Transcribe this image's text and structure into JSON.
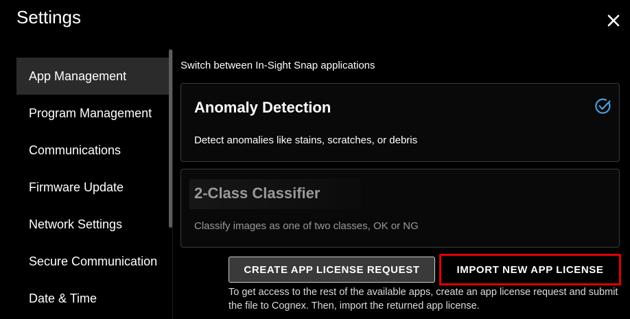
{
  "header": {
    "title": "Settings"
  },
  "sidebar": {
    "items": [
      {
        "label": "App Management",
        "active": true
      },
      {
        "label": "Program Management"
      },
      {
        "label": "Communications"
      },
      {
        "label": "Firmware Update"
      },
      {
        "label": "Network Settings"
      },
      {
        "label": "Secure Communication"
      },
      {
        "label": "Date & Time"
      }
    ]
  },
  "main": {
    "subtitle": "Switch between In-Sight Snap applications",
    "apps": [
      {
        "title": "Anomaly Detection",
        "description": "Detect anomalies like stains, scratches, or debris",
        "selected": true
      },
      {
        "title": "2-Class Classifier",
        "description": "Classify images as one of two classes, OK or NG",
        "selected": false
      }
    ],
    "buttons": {
      "create_license": "CREATE APP LICENSE REQUEST",
      "import_license": "IMPORT NEW APP LICENSE"
    },
    "help_text": "To get access to the rest of the available apps, create an app license request and submit the file to Cognex. Then, import the returned app license."
  },
  "colors": {
    "check": "#4a9fe0",
    "highlight": "#e00000",
    "background": "#000000"
  },
  "icons": {
    "close": "close-icon",
    "check": "check-circle-icon"
  }
}
